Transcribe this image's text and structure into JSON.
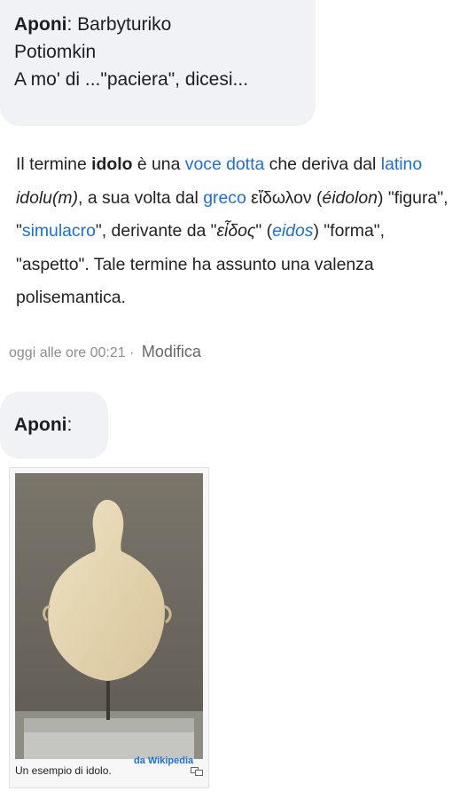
{
  "message1": {
    "author": "Aponi",
    "separator": ": ",
    "line1": "Barbyturiko",
    "line2": "Potiomkin",
    "line3": "A mo' di ...\"paciera\", dicesi..."
  },
  "quote": {
    "t1": "Il termine ",
    "t2": "idolo",
    "t3": " è una ",
    "l1": "voce dotta",
    "t4": " che deriva dal ",
    "l2": "latino",
    "t5": " ",
    "t6": "idolu(m)",
    "t7": ", a sua volta dal ",
    "l3": "greco",
    "t8": " εἴδωλον (",
    "t9": "éidolon",
    "t10": ") \"figura\", \"",
    "l4": "simulacro",
    "t11": "\", derivante da \"",
    "t12": "εἶδος",
    "t13": "\" (",
    "l5": "eidos",
    "t14": ") \"forma\", \"aspetto\". Tale termine ha assunto una valenza polisemantica."
  },
  "meta": {
    "timestamp": "oggi alle ore 00:21",
    "separator": " · ",
    "edit_label": "Modifica"
  },
  "message2": {
    "author": "Aponi",
    "separator": ":"
  },
  "image": {
    "caption": "Un esempio di idolo.",
    "watermark": "da Wikipedia",
    "enlarge_icon": "enlarge-icon",
    "colors": {
      "background": "#6f6b62",
      "idol": "#e6d6b0",
      "base": "#cfd0cb"
    }
  },
  "colors": {
    "bubble": "#f0f2f5",
    "link": "#1a6fe0",
    "meta": "#8a8d91"
  }
}
